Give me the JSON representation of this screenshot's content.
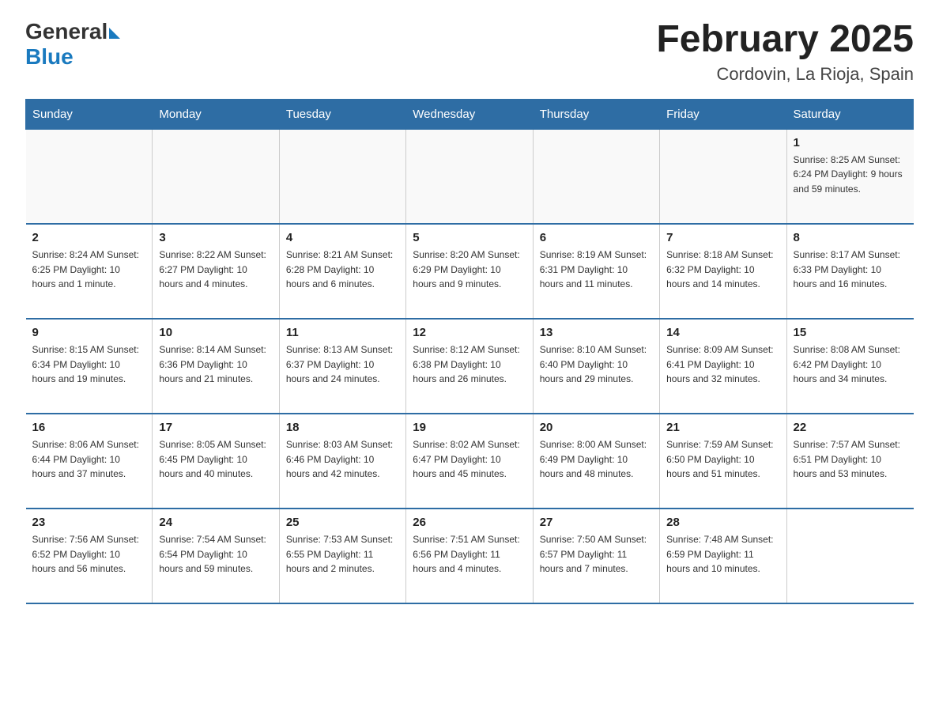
{
  "logo": {
    "general": "General",
    "blue": "Blue"
  },
  "title": "February 2025",
  "subtitle": "Cordovin, La Rioja, Spain",
  "days_header": [
    "Sunday",
    "Monday",
    "Tuesday",
    "Wednesday",
    "Thursday",
    "Friday",
    "Saturday"
  ],
  "weeks": [
    [
      {
        "day": "",
        "info": ""
      },
      {
        "day": "",
        "info": ""
      },
      {
        "day": "",
        "info": ""
      },
      {
        "day": "",
        "info": ""
      },
      {
        "day": "",
        "info": ""
      },
      {
        "day": "",
        "info": ""
      },
      {
        "day": "1",
        "info": "Sunrise: 8:25 AM\nSunset: 6:24 PM\nDaylight: 9 hours and 59 minutes."
      }
    ],
    [
      {
        "day": "2",
        "info": "Sunrise: 8:24 AM\nSunset: 6:25 PM\nDaylight: 10 hours and 1 minute."
      },
      {
        "day": "3",
        "info": "Sunrise: 8:22 AM\nSunset: 6:27 PM\nDaylight: 10 hours and 4 minutes."
      },
      {
        "day": "4",
        "info": "Sunrise: 8:21 AM\nSunset: 6:28 PM\nDaylight: 10 hours and 6 minutes."
      },
      {
        "day": "5",
        "info": "Sunrise: 8:20 AM\nSunset: 6:29 PM\nDaylight: 10 hours and 9 minutes."
      },
      {
        "day": "6",
        "info": "Sunrise: 8:19 AM\nSunset: 6:31 PM\nDaylight: 10 hours and 11 minutes."
      },
      {
        "day": "7",
        "info": "Sunrise: 8:18 AM\nSunset: 6:32 PM\nDaylight: 10 hours and 14 minutes."
      },
      {
        "day": "8",
        "info": "Sunrise: 8:17 AM\nSunset: 6:33 PM\nDaylight: 10 hours and 16 minutes."
      }
    ],
    [
      {
        "day": "9",
        "info": "Sunrise: 8:15 AM\nSunset: 6:34 PM\nDaylight: 10 hours and 19 minutes."
      },
      {
        "day": "10",
        "info": "Sunrise: 8:14 AM\nSunset: 6:36 PM\nDaylight: 10 hours and 21 minutes."
      },
      {
        "day": "11",
        "info": "Sunrise: 8:13 AM\nSunset: 6:37 PM\nDaylight: 10 hours and 24 minutes."
      },
      {
        "day": "12",
        "info": "Sunrise: 8:12 AM\nSunset: 6:38 PM\nDaylight: 10 hours and 26 minutes."
      },
      {
        "day": "13",
        "info": "Sunrise: 8:10 AM\nSunset: 6:40 PM\nDaylight: 10 hours and 29 minutes."
      },
      {
        "day": "14",
        "info": "Sunrise: 8:09 AM\nSunset: 6:41 PM\nDaylight: 10 hours and 32 minutes."
      },
      {
        "day": "15",
        "info": "Sunrise: 8:08 AM\nSunset: 6:42 PM\nDaylight: 10 hours and 34 minutes."
      }
    ],
    [
      {
        "day": "16",
        "info": "Sunrise: 8:06 AM\nSunset: 6:44 PM\nDaylight: 10 hours and 37 minutes."
      },
      {
        "day": "17",
        "info": "Sunrise: 8:05 AM\nSunset: 6:45 PM\nDaylight: 10 hours and 40 minutes."
      },
      {
        "day": "18",
        "info": "Sunrise: 8:03 AM\nSunset: 6:46 PM\nDaylight: 10 hours and 42 minutes."
      },
      {
        "day": "19",
        "info": "Sunrise: 8:02 AM\nSunset: 6:47 PM\nDaylight: 10 hours and 45 minutes."
      },
      {
        "day": "20",
        "info": "Sunrise: 8:00 AM\nSunset: 6:49 PM\nDaylight: 10 hours and 48 minutes."
      },
      {
        "day": "21",
        "info": "Sunrise: 7:59 AM\nSunset: 6:50 PM\nDaylight: 10 hours and 51 minutes."
      },
      {
        "day": "22",
        "info": "Sunrise: 7:57 AM\nSunset: 6:51 PM\nDaylight: 10 hours and 53 minutes."
      }
    ],
    [
      {
        "day": "23",
        "info": "Sunrise: 7:56 AM\nSunset: 6:52 PM\nDaylight: 10 hours and 56 minutes."
      },
      {
        "day": "24",
        "info": "Sunrise: 7:54 AM\nSunset: 6:54 PM\nDaylight: 10 hours and 59 minutes."
      },
      {
        "day": "25",
        "info": "Sunrise: 7:53 AM\nSunset: 6:55 PM\nDaylight: 11 hours and 2 minutes."
      },
      {
        "day": "26",
        "info": "Sunrise: 7:51 AM\nSunset: 6:56 PM\nDaylight: 11 hours and 4 minutes."
      },
      {
        "day": "27",
        "info": "Sunrise: 7:50 AM\nSunset: 6:57 PM\nDaylight: 11 hours and 7 minutes."
      },
      {
        "day": "28",
        "info": "Sunrise: 7:48 AM\nSunset: 6:59 PM\nDaylight: 11 hours and 10 minutes."
      },
      {
        "day": "",
        "info": ""
      }
    ]
  ]
}
